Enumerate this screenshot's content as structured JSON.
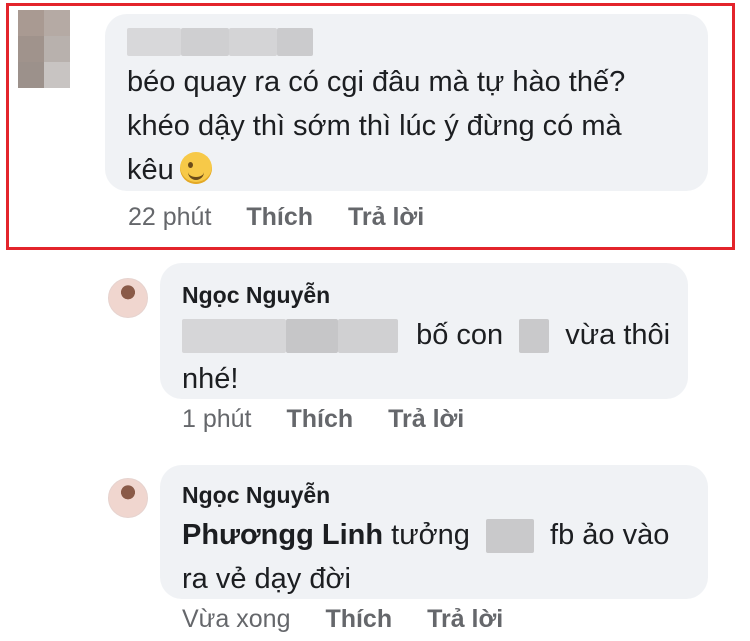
{
  "comments": [
    {
      "author": "",
      "lines": [
        "béo quay ra có cgi đâu mà tự hào thế?",
        "khéo dậy thì sớm thì lúc ý đừng có mà",
        "kêu"
      ],
      "emoji": "wink-emoji",
      "time": "22 phút",
      "like": "Thích",
      "reply": "Trả lời"
    },
    {
      "author": "Ngọc Nguyễn",
      "line1_text": "bố con",
      "line1_end": "vừa thôi",
      "line2": "nhé!",
      "time": "1 phút",
      "like": "Thích",
      "reply": "Trả lời"
    },
    {
      "author": "Ngọc Nguyễn",
      "mention": "Phươngg Linh",
      "line1_mid": "tưởng",
      "line1_end": "fb ảo vào",
      "line2": "ra vẻ dạy đời",
      "time": "Vừa xong",
      "like": "Thích",
      "reply": "Trả lời"
    }
  ],
  "colors": {
    "highlight": "#e3242b",
    "bubble": "#f0f2f5",
    "meta": "#65676b",
    "blur": "#c9c9cb"
  }
}
